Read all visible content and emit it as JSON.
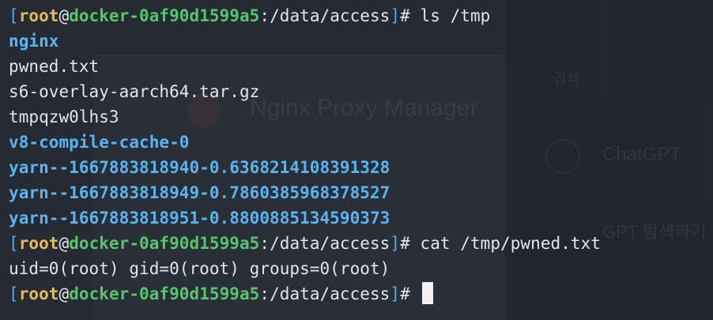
{
  "background_text": {
    "app_title": "Nginx Proxy Manager",
    "chatgpt": "ChatGPT",
    "gpt_search": "GPT 탐색하기",
    "search": "검색"
  },
  "prompt": {
    "open_bracket": "[",
    "user": "root",
    "at": "@",
    "host": "docker-0af90d1599a5",
    "colon": ":",
    "path": "/data/access",
    "close_bracket": "]",
    "symbol": "#"
  },
  "commands": {
    "ls": "ls /tmp",
    "cat": "cat /tmp/pwned.txt"
  },
  "ls_output": [
    {
      "name": "nginx",
      "type": "dir"
    },
    {
      "name": "pwned.txt",
      "type": "file"
    },
    {
      "name": "s6-overlay-aarch64.tar.gz",
      "type": "file"
    },
    {
      "name": "tmpqzw0lhs3",
      "type": "file"
    },
    {
      "name": "v8-compile-cache-0",
      "type": "dir"
    },
    {
      "name": "yarn--1667883818940-0.6368214108391328",
      "type": "dir"
    },
    {
      "name": "yarn--1667883818949-0.7860385968378527",
      "type": "dir"
    },
    {
      "name": "yarn--1667883818951-0.8800885134590373",
      "type": "dir"
    }
  ],
  "cat_output": "uid=0(root) gid=0(root) groups=0(root)",
  "colors": {
    "background": "#262a33",
    "bracket": "#5aa8e8",
    "user": "#e6b95a",
    "host": "#57c66b",
    "directory": "#5ab4f0",
    "text": "#e3e6ea"
  }
}
